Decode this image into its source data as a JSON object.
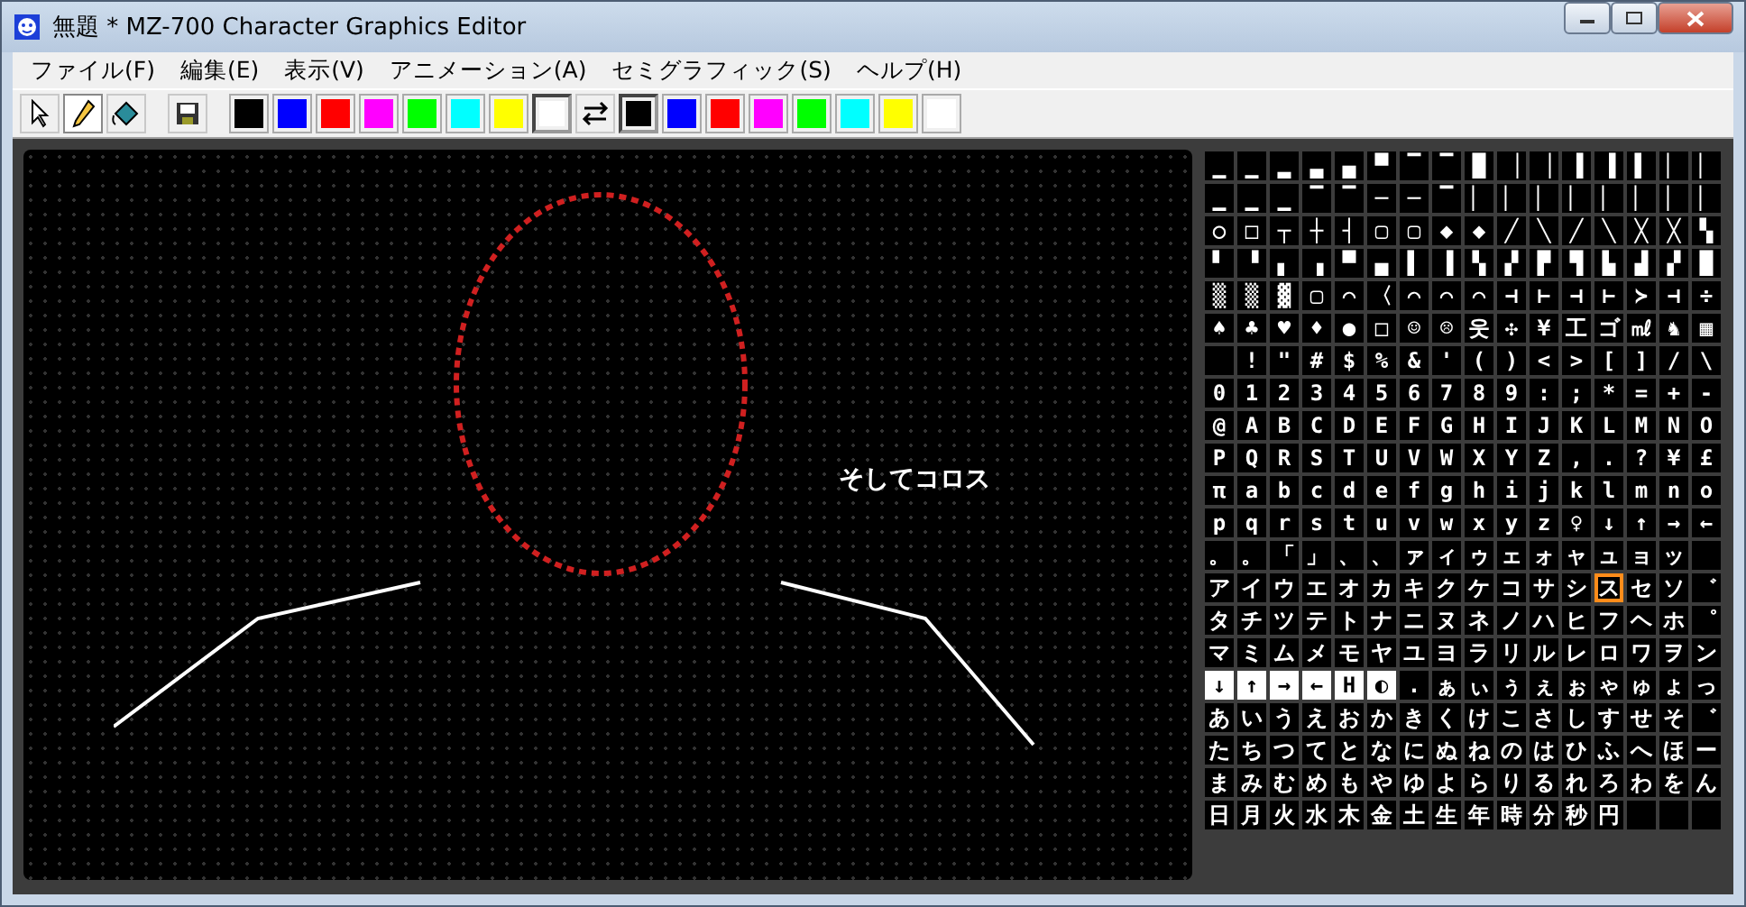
{
  "window": {
    "title": "無題 * MZ-700 Character Graphics Editor"
  },
  "menu": [
    "ファイル(F)",
    "編集(E)",
    "表示(V)",
    "アニメーション(A)",
    "セミグラフィック(S)",
    "ヘルプ(H)"
  ],
  "toolbar": {
    "tools": [
      {
        "kind": "pointer",
        "selected": false
      },
      {
        "kind": "pencil",
        "selected": true
      },
      {
        "kind": "fill",
        "selected": false
      }
    ],
    "foreground": [
      {
        "color": "#000000",
        "selected": false
      },
      {
        "color": "#0000ff",
        "selected": false
      },
      {
        "color": "#ff0000",
        "selected": false
      },
      {
        "color": "#ff00ff",
        "selected": false
      },
      {
        "color": "#00ff00",
        "selected": false
      },
      {
        "color": "#00ffff",
        "selected": false
      },
      {
        "color": "#ffff00",
        "selected": false
      },
      {
        "color": "#ffffff",
        "selected": true
      }
    ],
    "background": [
      {
        "color": "#000000",
        "selected": true
      },
      {
        "color": "#0000ff",
        "selected": false
      },
      {
        "color": "#ff0000",
        "selected": false
      },
      {
        "color": "#ff00ff",
        "selected": false
      },
      {
        "color": "#00ff00",
        "selected": false
      },
      {
        "color": "#00ffff",
        "selected": false
      },
      {
        "color": "#ffff00",
        "selected": false
      },
      {
        "color": "#ffffff",
        "selected": false
      }
    ]
  },
  "canvas": {
    "caption": "そしてコロス"
  },
  "palette": [
    [
      "▁",
      "▁",
      "▂",
      "▃",
      "▄",
      "▀",
      "▔",
      "▔",
      "█",
      "▕",
      "▕",
      "▐",
      "▐",
      "▌",
      "▏",
      "▏"
    ],
    [
      "▁",
      "▁",
      "▁",
      "▔",
      "▔",
      "─",
      "─",
      "▔",
      "▏",
      "▏",
      "▏",
      "▏",
      "▏",
      "▏",
      "▏",
      "▏"
    ],
    [
      "○",
      "□",
      "┬",
      "┼",
      "┤",
      "▢",
      "▢",
      "◆",
      "◆",
      "╱",
      "╲",
      "╱",
      "╲",
      "╳",
      "╳",
      "▚"
    ],
    [
      "▘",
      "▝",
      "▖",
      "▗",
      "▀",
      "▄",
      "▌",
      "▐",
      "▚",
      "▞",
      "▛",
      "▜",
      "▙",
      "▟",
      "▞",
      "█"
    ],
    [
      "▒",
      "▒",
      "▓",
      "▢",
      "⌒",
      "〈",
      "⌒",
      "⌒",
      "⌒",
      "⊣",
      "⊢",
      "⊣",
      "⊢",
      "≻",
      "⊣",
      "÷"
    ],
    [
      "♠",
      "♣",
      "♥",
      "♦",
      "●",
      "□",
      "☺",
      "☹",
      "웃",
      "✣",
      "¥",
      "工",
      "ゴ",
      "㎖",
      "♞",
      "▦"
    ],
    [
      {
        "kind": "blank"
      },
      "!",
      "\"",
      "#",
      "$",
      "%",
      "&",
      "'",
      "(",
      ")",
      "<",
      ">",
      "[",
      "]",
      "/",
      "\\"
    ],
    [
      "0",
      "1",
      "2",
      "3",
      "4",
      "5",
      "6",
      "7",
      "8",
      "9",
      ":",
      ";",
      "*",
      "=",
      "+",
      "-"
    ],
    [
      "@",
      "A",
      "B",
      "C",
      "D",
      "E",
      "F",
      "G",
      "H",
      "I",
      "J",
      "K",
      "L",
      "M",
      "N",
      "O"
    ],
    [
      "P",
      "Q",
      "R",
      "S",
      "T",
      "U",
      "V",
      "W",
      "X",
      "Y",
      "Z",
      ",",
      ".",
      "?",
      "¥",
      "£"
    ],
    [
      "π",
      "a",
      "b",
      "c",
      "d",
      "e",
      "f",
      "g",
      "h",
      "i",
      "j",
      "k",
      "l",
      "m",
      "n",
      "o"
    ],
    [
      "p",
      "q",
      "r",
      "s",
      "t",
      "u",
      "v",
      "w",
      "x",
      "y",
      "z",
      "♀",
      "↓",
      "↑",
      "→",
      "←"
    ],
    [
      "。",
      "。",
      "「",
      "」",
      "、",
      "、",
      "ァ",
      "ィ",
      "ゥ",
      "ェ",
      "ォ",
      "ャ",
      "ュ",
      "ョ",
      "ッ",
      {
        "kind": "blank"
      }
    ],
    [
      "ア",
      "イ",
      "ウ",
      "エ",
      "オ",
      "カ",
      "キ",
      "ク",
      "ケ",
      "コ",
      "サ",
      "シ",
      {
        "text": "ス",
        "selected": true,
        "inverse": false
      },
      "セ",
      "ソ",
      "゛"
    ],
    [
      "タ",
      "チ",
      "ツ",
      "テ",
      "ト",
      "ナ",
      "ニ",
      "ヌ",
      "ネ",
      "ノ",
      "ハ",
      "ヒ",
      "フ",
      "ヘ",
      "ホ",
      "゜"
    ],
    [
      "マ",
      "ミ",
      "ム",
      "メ",
      "モ",
      "ヤ",
      "ユ",
      "ヨ",
      "ラ",
      "リ",
      "ル",
      "レ",
      "ロ",
      "ワ",
      "ヲ",
      "ン"
    ],
    [
      {
        "text": "↓",
        "selected": false,
        "inverse": true
      },
      {
        "text": "↑",
        "selected": false,
        "inverse": true
      },
      {
        "text": "→",
        "selected": false,
        "inverse": true
      },
      {
        "text": "←",
        "selected": false,
        "inverse": true
      },
      {
        "text": "H",
        "selected": false,
        "inverse": true
      },
      {
        "text": "◐",
        "selected": false,
        "inverse": true
      },
      ".",
      "ぁ",
      "ぃ",
      "ぅ",
      "ぇ",
      "ぉ",
      "ゃ",
      "ゅ",
      "ょ",
      "っ"
    ],
    [
      "あ",
      "い",
      "う",
      "え",
      "お",
      "か",
      "き",
      "く",
      "け",
      "こ",
      "さ",
      "し",
      "す",
      "せ",
      "そ",
      "゛"
    ],
    [
      "た",
      "ち",
      "つ",
      "て",
      "と",
      "な",
      "に",
      "ぬ",
      "ね",
      "の",
      "は",
      "ひ",
      "ふ",
      "へ",
      "ほ",
      "ー"
    ],
    [
      "ま",
      "み",
      "む",
      "め",
      "も",
      "や",
      "ゆ",
      "よ",
      "ら",
      "り",
      "る",
      "れ",
      "ろ",
      "わ",
      "を",
      "ん"
    ],
    [
      "日",
      "月",
      "火",
      "水",
      "木",
      "金",
      "土",
      "生",
      "年",
      "時",
      "分",
      "秒",
      "円",
      {
        "kind": "blank"
      },
      {
        "kind": "blank"
      },
      {
        "kind": "blank"
      }
    ]
  ]
}
